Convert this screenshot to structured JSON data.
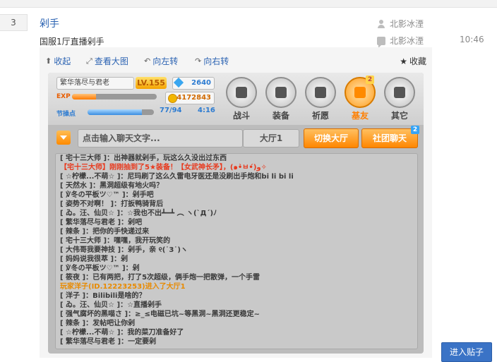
{
  "post": {
    "number": "3",
    "title": "剁手",
    "subtitle": "国服1厅直播剁手",
    "author": "北影冰湮",
    "last_reply": "北影冰湮",
    "time": "10:46"
  },
  "toolbar": {
    "collapse": "收起",
    "view_large": "查看大图",
    "rotate_left": "向左转",
    "rotate_right": "向右转",
    "favorite": "收藏"
  },
  "game": {
    "player_name": "繁华落尽与君老",
    "level": "LV.155",
    "diamonds": "2640",
    "exp_label": "EXP",
    "exp_progress": 0.28,
    "gold": "4172843",
    "ap_label": "节操点",
    "ap_value": "77/94",
    "ap_progress": 0.82,
    "ap_time": "4:16",
    "menu": [
      {
        "label": "战斗"
      },
      {
        "label": "装备"
      },
      {
        "label": "祈愿"
      },
      {
        "label": "基友",
        "badge": "2"
      },
      {
        "label": "其它"
      }
    ],
    "chat_placeholder": "点击输入聊天文字...",
    "hall": "大厅1",
    "switch_hall": "切换大厅",
    "club_chat": "社团聊天",
    "club_badge": "2",
    "chat": [
      "[ 宅十三大师 ]：出神器就剁手，玩这么久没出过东西",
      "【宅十三大师】刚刚抽到了5★装备！【女武神长矛】，(๑•̀ㅂ•́)و✧",
      "[ ☆柠檬...不萌☆ ]：尼玛刷了这么久雷电牙医还是没刷出手炮和bi li bi li",
      "[ 天然水 ]：黑洞超级有地火吗？",
      "[ ℣冬の平板ツ♡™ ]：剁手吧",
      "[ 姿势不对啊！ ]：打扳鸭骑背后",
      "[ ゐ。汪、仙贝☆ ]：☆我也不出┻━┻ ︵ ヽ(`Д´)ﾉ",
      "[ 繁华落尽与君老 ]：剁吧",
      "[ 辣条 ]：把你的手快递过来",
      "[ 宅十三大师 ]：嘿嘿，我开玩笑的",
      "[ 大伟哥我要神技 ]：剁手，亲 ୧(˙3˙)ヽ",
      "[ 妈妈说我很萃 ]：剁",
      "[ ℣冬の平板ツ♡™ ]：剁",
      "[ 筱夜 ]：已有两把，打了5次超级，俩手炮一把散弹，一个手雷",
      "玩家洋子(ID.12223253)进入了大厅1",
      "[ 洋子 ]：Bilibili是啥的？",
      "[ ゐ。汪、仙贝☆ ]：☆直播剁手",
      "[ 强气腐坏的黑喵さ ]：≥_≤电磁已坑~等黑洞~黑洞还更稳定~",
      "[ 辣条 ]：发帖吧让你剁",
      "[ ☆柠檬...不萌☆ ]：我的菜刀准备好了",
      "[ 繁华落尽与君老 ]：一定要剁"
    ]
  },
  "footer": {
    "enter_thread": "进入贴子"
  }
}
